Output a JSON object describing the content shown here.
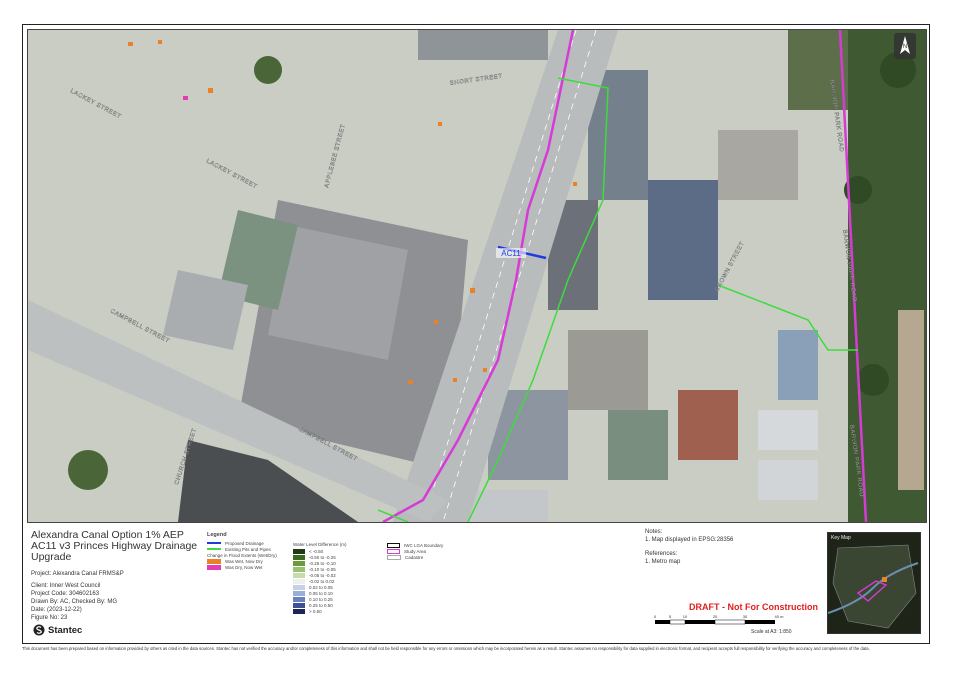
{
  "map": {
    "streets": [
      "LACKEY STREET",
      "LACKEY STREET",
      "SHORT STREET",
      "APPLEBEE STREET",
      "CAMPBELL STREET",
      "CAMPBELL STREET",
      "CHURCH STREET",
      "CROWN STREET",
      "BARWON PARK ROAD",
      "BARWON PARK ROAD",
      "BARWON PARK ROAD"
    ],
    "drainage_label": "AC11",
    "north_arrow_label": "N",
    "colors": {
      "proposed_drainage": "#1e3cdc",
      "existing_pits_pipes": "#3ddc3d",
      "study_area": "#d63bd6",
      "was_wet_now_dry": "#e8822a",
      "was_dry_now_wet": "#e83ab0"
    }
  },
  "title": {
    "line1": "Alexandra Canal Option 1% AEP",
    "line2": "AC11 v3 Princes Highway Drainage",
    "line3": "Upgrade"
  },
  "project": {
    "project_line": "Project: Alexandra Canal FRMS&P",
    "client_line": "Client:  Inner West Council",
    "code_line": "Project Code:  304602163",
    "drawn_line": "Drawn By:   AC,  Checked By: MG",
    "date_line": "Date:    (2023-12-22)",
    "figure_line": "Figure No:  23"
  },
  "legend": {
    "title": "Legend",
    "proposed_drainage": "Proposed Drainage",
    "existing_pits": "Existing Pits and Pipes",
    "flood_extents_header": "Change in Flood Extents (Wet/Dry)",
    "was_wet_now_dry": "Was Wet, Now Dry",
    "was_dry_now_wet": "Was Dry, Now Wet",
    "wld_header": "Water Level Difference (m)",
    "wld_classes": [
      {
        "label": "< -0.50",
        "color": "#1f3a12"
      },
      {
        "label": "-0.50 to -0.25",
        "color": "#3d6a22"
      },
      {
        "label": "-0.25 to -0.10",
        "color": "#6c9a3c"
      },
      {
        "label": "-0.10 to -0.05",
        "color": "#9cc073"
      },
      {
        "label": "-0.05 to -0.02",
        "color": "#c6dcab"
      },
      {
        "label": "-0.02 to 0.02",
        "color": "#eeeeee"
      },
      {
        "label": "0.02 to 0.05",
        "color": "#c6d0e6"
      },
      {
        "label": "0.05 to 0.10",
        "color": "#9aaed6"
      },
      {
        "label": "0.10 to 0.25",
        "color": "#6a82bc"
      },
      {
        "label": "0.25 to 0.50",
        "color": "#3e5192"
      },
      {
        "label": "> 0.50",
        "color": "#1d2458"
      }
    ],
    "lga_boundary": "IWC LGA Boundary",
    "study_area": "Study Area",
    "cadastre": "Cadastre"
  },
  "notes": {
    "notes_title": "Notes:",
    "note1": "1. Map displayed in EPSG:28356",
    "refs_title": "References:",
    "ref1": "1. Metro map"
  },
  "draft": "DRAFT - Not For Construction",
  "scale": {
    "ticks": [
      "0",
      "5",
      "10",
      "20",
      "30",
      "40 m"
    ],
    "scale_text": "Scale at A3: 1:850"
  },
  "keymap": {
    "title": "Key Map"
  },
  "brand": "Stantec",
  "disclaimer": "This document has been prepared based on information provided by others as cited in the data sources. Stantec has not verified the accuracy and/or completeness of this information and shall not be held responsible for any errors or omissions which may be incorporated herein as a result. Stantec assumes no responsibility for data supplied in electronic format, and recipient accepts full responsibility for verifying the accuracy and completeness of the data."
}
